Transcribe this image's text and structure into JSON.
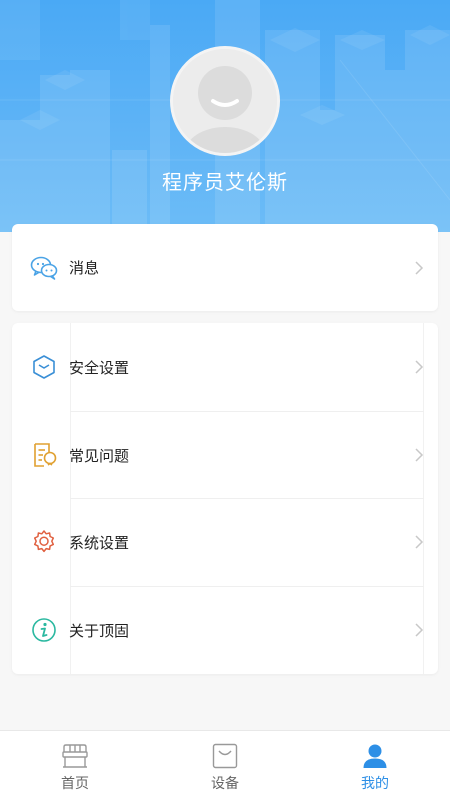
{
  "profile": {
    "username": "程序员艾伦斯"
  },
  "menu_group_1": [
    {
      "label": "消息",
      "icon": "chat-bubbles-icon",
      "color": "#4aa3e6"
    }
  ],
  "menu_group_2": [
    {
      "label": "安全设置",
      "icon": "security-box-icon",
      "color": "#3a8fd6"
    },
    {
      "label": "常见问题",
      "icon": "faq-document-icon",
      "color": "#e0a030"
    },
    {
      "label": "系统设置",
      "icon": "gear-icon",
      "color": "#e06040"
    },
    {
      "label": "关于顶固",
      "icon": "info-icon",
      "color": "#2ab8a0"
    }
  ],
  "tabbar": {
    "tabs": [
      {
        "label": "首页",
        "icon": "home-icon",
        "active": false
      },
      {
        "label": "设备",
        "icon": "device-bag-icon",
        "active": false
      },
      {
        "label": "我的",
        "icon": "user-icon",
        "active": true
      }
    ]
  },
  "colors": {
    "header": "#4aa9f5",
    "active_tab": "#2d8fe6",
    "inactive_tab": "#666666"
  }
}
